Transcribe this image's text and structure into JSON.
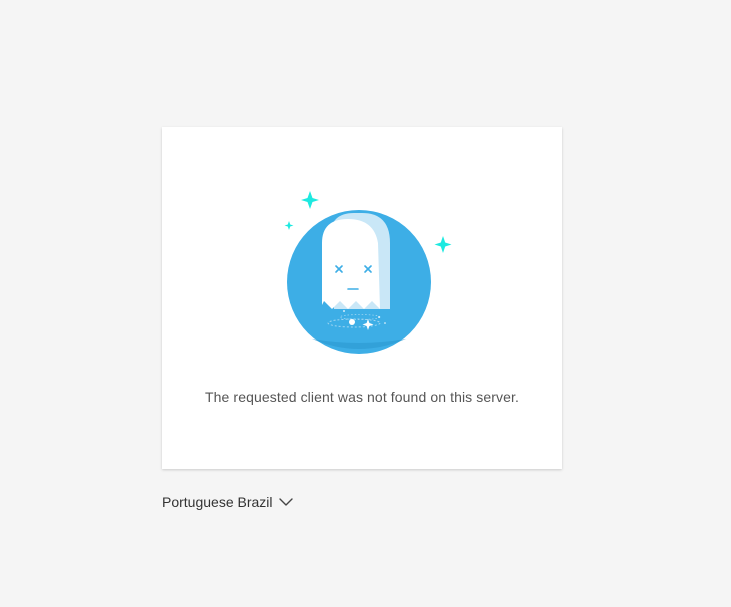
{
  "error": {
    "message": "The requested client was not found on this server.",
    "illustration_icon": "ghost-error-icon",
    "colors": {
      "circle": "#3daee6",
      "sparkle": "#1de9e0",
      "ghost": "#ffffff"
    }
  },
  "language": {
    "selected": "Portuguese Brazil",
    "icon": "chevron-down-icon"
  }
}
